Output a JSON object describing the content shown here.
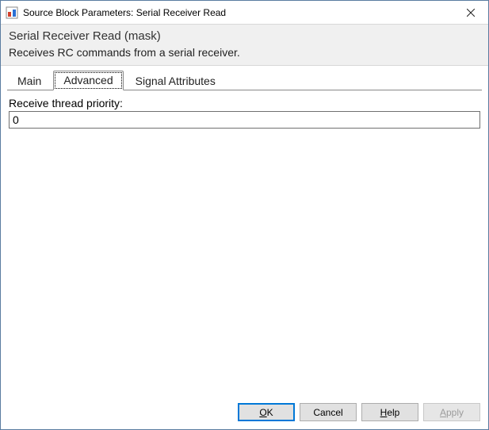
{
  "window": {
    "title": "Source Block Parameters: Serial Receiver Read"
  },
  "mask": {
    "title": "Serial Receiver Read (mask)",
    "description": "Receives RC commands from a serial receiver."
  },
  "tabs": {
    "main": "Main",
    "advanced": "Advanced",
    "signal_attributes": "Signal Attributes",
    "active": "advanced"
  },
  "fields": {
    "receive_priority": {
      "label": "Receive thread priority:",
      "value": "0"
    }
  },
  "buttons": {
    "ok_prefix": "O",
    "ok_rest": "K",
    "cancel": "Cancel",
    "help_prefix": "H",
    "help_rest": "elp",
    "apply_prefix": "A",
    "apply_rest": "pply"
  }
}
